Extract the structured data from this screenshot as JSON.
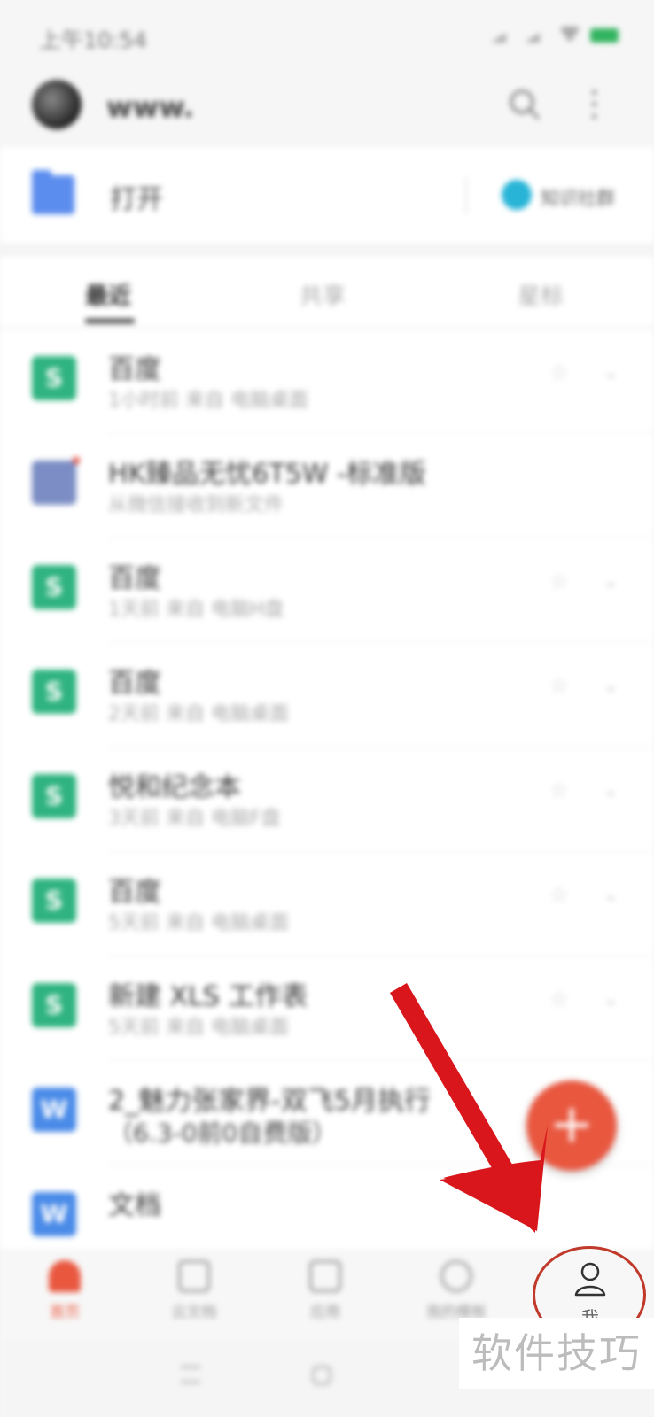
{
  "status_bar": {
    "time": "上午10:54"
  },
  "header": {
    "username": "www."
  },
  "open_bar": {
    "label": "打开",
    "note_label": "知识社群"
  },
  "tabs": [
    {
      "label": "最近",
      "active": true
    },
    {
      "label": "共享",
      "active": false
    },
    {
      "label": "星标",
      "active": false
    }
  ],
  "files": [
    {
      "type": "s",
      "icon_letter": "S",
      "title": "百度",
      "subtitle": "1小时前    来自 电脑桌面"
    },
    {
      "type": "img",
      "icon_letter": "",
      "title": "HK臻品无忧6T5W -标准版",
      "subtitle": "从微信接收到新文件"
    },
    {
      "type": "s",
      "icon_letter": "S",
      "title": "百度",
      "subtitle": "1天前    来自 电脑H盘"
    },
    {
      "type": "s",
      "icon_letter": "S",
      "title": "百度",
      "subtitle": "2天前    来自 电脑桌面"
    },
    {
      "type": "s",
      "icon_letter": "S",
      "title": "悦和纪念本",
      "subtitle": "3天前    来自 电脑F盘"
    },
    {
      "type": "s",
      "icon_letter": "S",
      "title": "百度",
      "subtitle": "5天前    来自 电脑桌面"
    },
    {
      "type": "s",
      "icon_letter": "S",
      "title": "新建 XLS 工作表",
      "subtitle": "5天前    来自 电脑桌面"
    },
    {
      "type": "w",
      "icon_letter": "W",
      "title": "2_魅力张家界-双飞5月执行",
      "subtitle": "（6.3-0前0自费版）"
    },
    {
      "type": "w",
      "icon_letter": "W",
      "title": "文档",
      "subtitle": ""
    }
  ],
  "fab": {
    "label": "+"
  },
  "bottom_nav": [
    {
      "label": "首页",
      "active": true
    },
    {
      "label": "云文档",
      "active": false
    },
    {
      "label": "应用",
      "active": false
    },
    {
      "label": "我的模板",
      "active": false
    },
    {
      "label": "我",
      "active": false
    }
  ],
  "watermark": {
    "text": "软件技巧"
  },
  "colors": {
    "accent": "#e9573f",
    "sheet_green": "#2fb380",
    "doc_blue": "#4a8be8",
    "annotation_red": "#d8161b"
  }
}
